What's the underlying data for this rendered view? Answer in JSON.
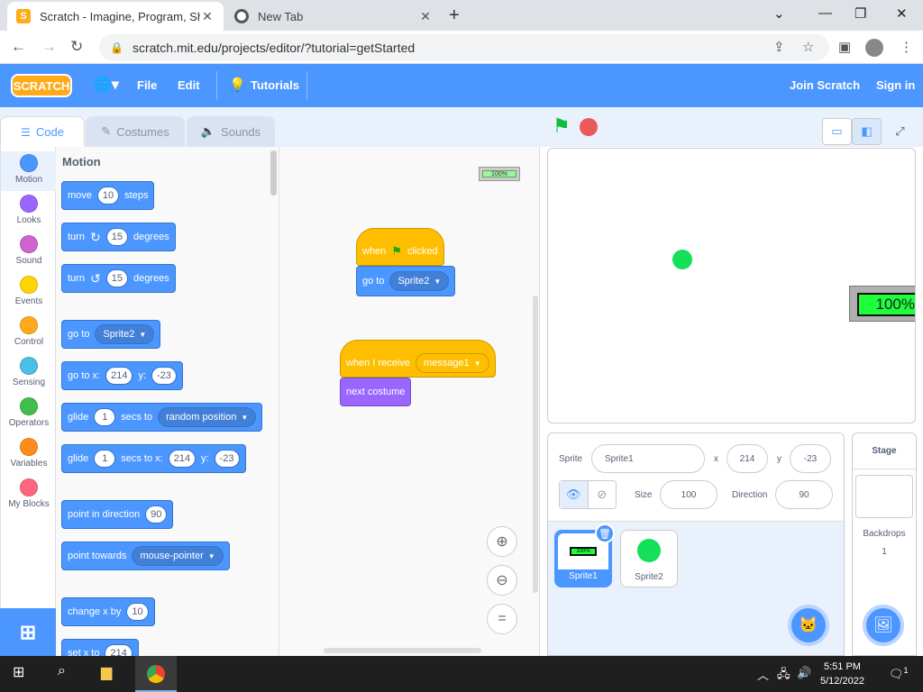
{
  "browser": {
    "tabs": [
      {
        "title": "Scratch - Imagine, Program, Shar",
        "favicon": "scratch-s-icon",
        "active": true
      },
      {
        "title": "New Tab",
        "favicon": "chrome-icon",
        "active": false
      }
    ],
    "url": "scratch.mit.edu/projects/editor/?tutorial=getStarted"
  },
  "menubar": {
    "logo": "SCRATCH",
    "file": "File",
    "edit": "Edit",
    "tutorials": "Tutorials",
    "join": "Join Scratch",
    "signin": "Sign in"
  },
  "editor_tabs": {
    "code": "Code",
    "costumes": "Costumes",
    "sounds": "Sounds"
  },
  "categories": [
    {
      "label": "Motion",
      "color": "#4c97ff"
    },
    {
      "label": "Looks",
      "color": "#9966ff"
    },
    {
      "label": "Sound",
      "color": "#cf63cf"
    },
    {
      "label": "Events",
      "color": "#ffd500"
    },
    {
      "label": "Control",
      "color": "#ffab19"
    },
    {
      "label": "Sensing",
      "color": "#4cbfe6"
    },
    {
      "label": "Operators",
      "color": "#40bf4a"
    },
    {
      "label": "Variables",
      "color": "#ff8c1a"
    },
    {
      "label": "My Blocks",
      "color": "#ff6680"
    }
  ],
  "palette": {
    "title": "Motion",
    "move": {
      "w1": "move",
      "n": "10",
      "w2": "steps"
    },
    "turn_cw": {
      "w1": "turn",
      "n": "15",
      "w2": "degrees"
    },
    "turn_ccw": {
      "w1": "turn",
      "n": "15",
      "w2": "degrees"
    },
    "goto": {
      "w1": "go to",
      "dd": "Sprite2"
    },
    "gotoxy": {
      "w1": "go to x:",
      "x": "214",
      "w2": "y:",
      "y": "-23"
    },
    "glide1": {
      "w1": "glide",
      "n": "1",
      "w2": "secs to",
      "dd": "random position"
    },
    "glide2": {
      "w1": "glide",
      "n": "1",
      "w2": "secs to x:",
      "x": "214",
      "w3": "y:",
      "y": "-23"
    },
    "point_dir": {
      "w1": "point in direction",
      "n": "90"
    },
    "point_towards": {
      "w1": "point towards",
      "dd": "mouse-pointer"
    },
    "change_x": {
      "w1": "change x by",
      "n": "10"
    },
    "set_x": {
      "w1": "set x to",
      "n": "214"
    }
  },
  "script": {
    "mini_monitor": "100%",
    "s1_hat": {
      "w1": "when",
      "w2": "clicked"
    },
    "s1_goto": {
      "w1": "go to",
      "dd": "Sprite2"
    },
    "s2_hat": {
      "w1": "when I receive",
      "dd": "message1"
    },
    "s2_next": "next costume"
  },
  "stage": {
    "monitor": "100%"
  },
  "sprite_info": {
    "sprite_label": "Sprite",
    "sprite_name": "Sprite1",
    "x_label": "x",
    "x": "214",
    "y_label": "y",
    "y": "-23",
    "size_label": "Size",
    "size": "100",
    "dir_label": "Direction",
    "dir": "90"
  },
  "sprites": [
    {
      "name": "Sprite1",
      "thumb_text": "100%"
    },
    {
      "name": "Sprite2"
    }
  ],
  "stage_selector": {
    "title": "Stage",
    "backdrops_label": "Backdrops",
    "backdrops_count": "1"
  },
  "taskbar": {
    "time": "5:51 PM",
    "date": "5/12/2022",
    "notifications": "1"
  }
}
